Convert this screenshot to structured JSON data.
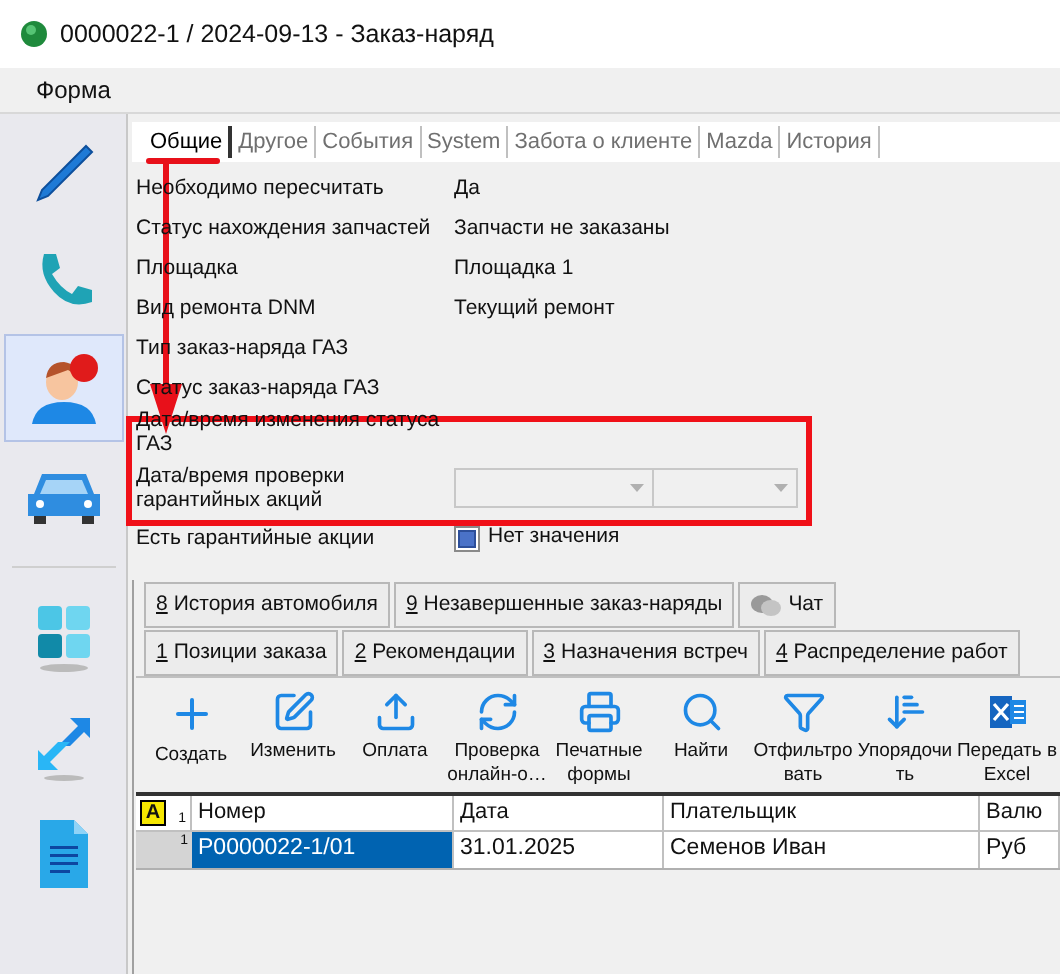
{
  "window": {
    "title": "0000022-1 / 2024-09-13 - Заказ-наряд"
  },
  "menu": [
    "Форма"
  ],
  "sidebar": {
    "items": [
      {
        "kind": "pen",
        "selected": false
      },
      {
        "kind": "phone",
        "selected": false
      },
      {
        "kind": "person",
        "selected": true
      },
      {
        "kind": "car",
        "selected": false
      },
      {
        "kind": "tiles",
        "selected": false
      },
      {
        "kind": "arrows",
        "selected": false
      },
      {
        "kind": "document",
        "selected": false
      }
    ]
  },
  "top_tabs": [
    {
      "label": "Общие",
      "selected": true
    },
    {
      "label": "Другое",
      "selected": false
    },
    {
      "label": "События",
      "selected": false
    },
    {
      "label": "System",
      "selected": false
    },
    {
      "label": "Забота о клиенте",
      "selected": false
    },
    {
      "label": "Mazda",
      "selected": false
    },
    {
      "label": "История",
      "selected": false
    }
  ],
  "fields": [
    {
      "kind": "text",
      "label": "Необходимо пересчитать",
      "value": "Да"
    },
    {
      "kind": "text",
      "label": "Статус нахождения запчастей",
      "value": "Запчасти не заказаны"
    },
    {
      "kind": "text",
      "label": "Площадка",
      "value": "Площадка 1"
    },
    {
      "kind": "text",
      "label": "Вид ремонта DNM",
      "value": "Текущий ремонт"
    },
    {
      "kind": "text",
      "label": "Тип заказ-наряда ГАЗ"
    },
    {
      "kind": "text",
      "label": "Статус заказ-наряда ГАЗ"
    },
    {
      "kind": "text",
      "label": "Дата/время изменения статуса ГАЗ"
    },
    {
      "kind": "datetime",
      "label": "Дата/время проверки гарантийных акций",
      "disabled": true
    },
    {
      "kind": "checkbox",
      "label": "Есть гарантийные акции",
      "value": "Нет значения",
      "indeterminate": true
    }
  ],
  "bottom_tabs": [
    [
      {
        "kind": "numbered",
        "key": "8",
        "label": "История автомобиля"
      },
      {
        "kind": "numbered",
        "key": "9",
        "label": "Незавершенные заказ-наряды"
      },
      {
        "kind": "chat",
        "label": "Чат"
      }
    ],
    [
      {
        "kind": "numbered",
        "key": "1",
        "label": "Позиции заказа"
      },
      {
        "kind": "numbered",
        "key": "2",
        "label": "Рекомендации"
      },
      {
        "kind": "numbered",
        "key": "3",
        "label": "Назначения встреч"
      },
      {
        "kind": "numbered",
        "key": "4",
        "label": "Распределение работ"
      }
    ]
  ],
  "toolbar": [
    {
      "lines": [
        "Создать"
      ]
    },
    {
      "lines": [
        "Изменить"
      ]
    },
    {
      "lines": [
        "Оплата"
      ]
    },
    {
      "lines": [
        "Проверка",
        "онлайн-о…"
      ]
    },
    {
      "lines": [
        "Печатные",
        "формы"
      ]
    },
    {
      "lines": [
        "Найти"
      ]
    },
    {
      "lines": [
        "Отфильтро",
        "вать"
      ]
    },
    {
      "lines": [
        "Упорядочи",
        "ть"
      ]
    },
    {
      "lines": [
        "Передать в",
        "Excel"
      ]
    }
  ],
  "table": {
    "filter_badge": "A",
    "header_number": "1",
    "columns": [
      "Номер",
      "Дата",
      "Плательщик",
      "Валю"
    ],
    "rows": [
      {
        "number": "1",
        "cells": [
          {
            "text": "P0000022-1/01",
            "selected": true
          },
          {
            "text": "31.01.2025",
            "selected": false
          },
          {
            "text": "Семенов Иван",
            "selected": false
          },
          {
            "text": "Руб",
            "selected": false
          }
        ]
      }
    ]
  }
}
